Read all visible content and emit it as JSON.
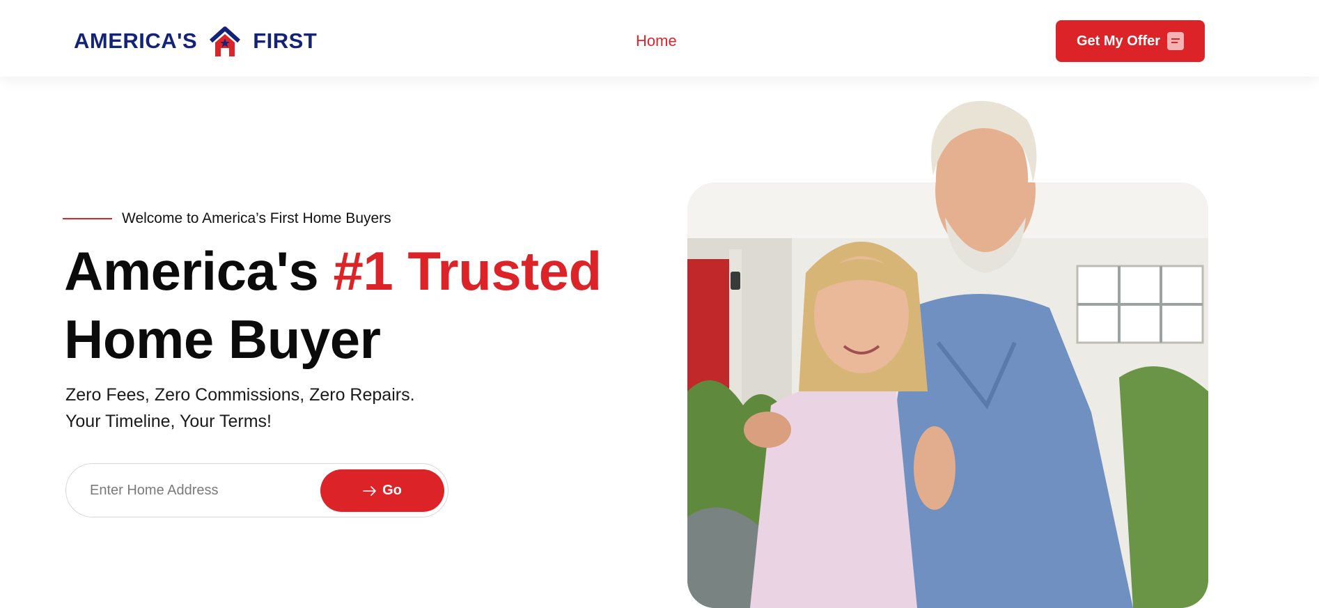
{
  "header": {
    "logo": {
      "left_text": "AMERICA'S",
      "right_text": "FIRST",
      "mark_icon": "house-star-icon"
    },
    "nav": [
      {
        "label": "Home"
      }
    ],
    "cta": {
      "label": "Get My Offer",
      "icon": "form-icon"
    }
  },
  "hero": {
    "eyebrow": "Welcome to America’s First Home Buyers",
    "headline_part1": "America's ",
    "headline_accent": "#1 Trusted",
    "headline_part2": "Home Buyer",
    "subtext_line1": "Zero Fees, Zero Commissions, Zero Repairs.",
    "subtext_line2": "Your Timeline, Your Terms!",
    "search": {
      "placeholder": "Enter Home Address",
      "value": "",
      "button_label": "Go",
      "button_icon": "arrow-right-icon"
    }
  },
  "colors": {
    "brand_red": "#dc2428",
    "brand_navy": "#14237a"
  },
  "image": {
    "subject": "smiling-couple-photo"
  }
}
